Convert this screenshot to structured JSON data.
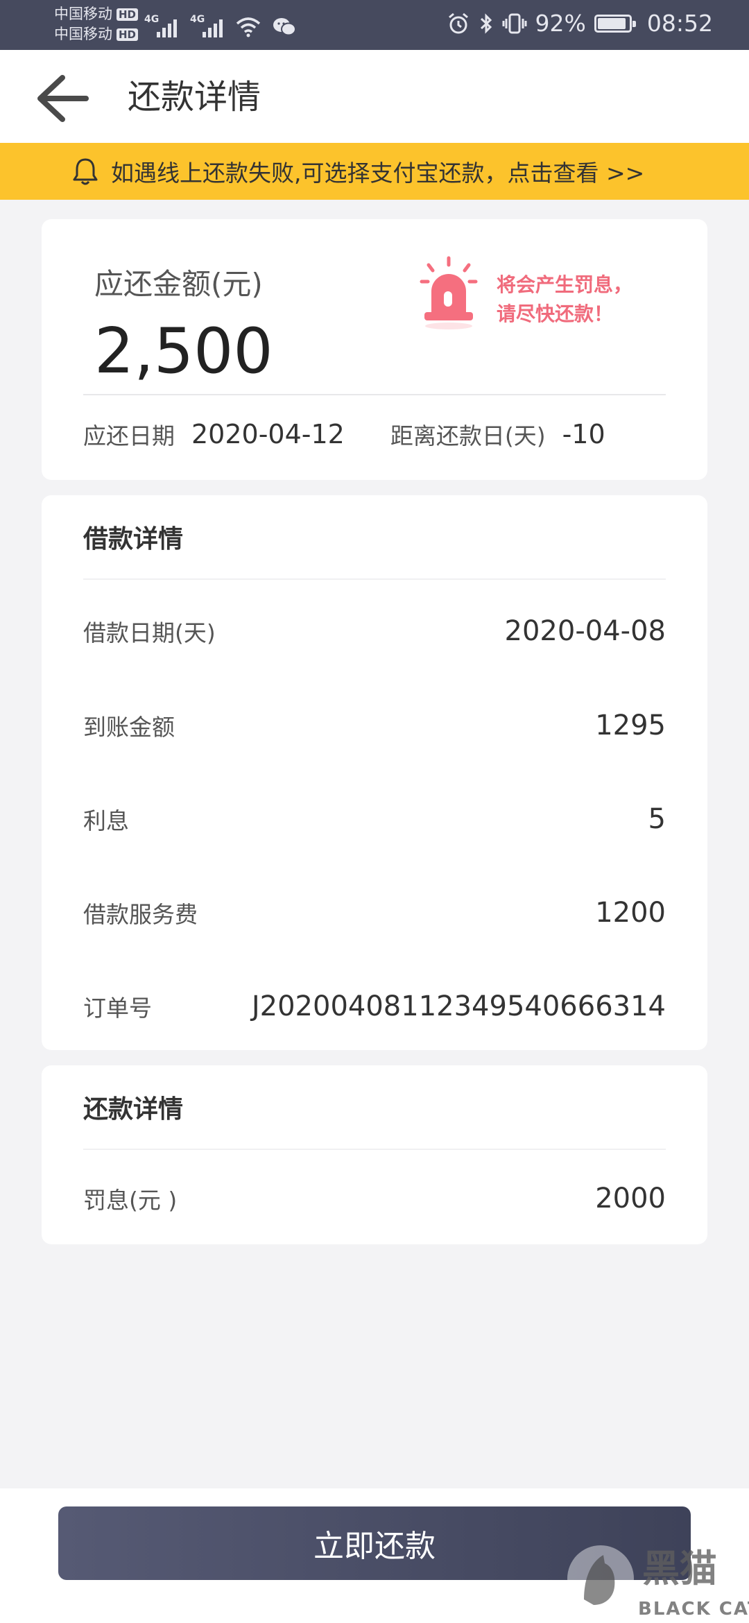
{
  "status_bar": {
    "carrier_1": "中国移动",
    "carrier_2": "中国移动",
    "hd_badge": "HD",
    "network_1": "4G",
    "network_2": "4G",
    "battery_percent": "92%",
    "battery_level": 0.92,
    "time": "08:52",
    "icons": [
      "signal-icon",
      "wifi-icon",
      "wechat-icon",
      "alarm-clock-icon",
      "bluetooth-icon",
      "vibrate-icon",
      "battery-icon"
    ]
  },
  "header": {
    "title": "还款详情",
    "back_icon": "arrow-left-icon"
  },
  "notice": {
    "icon": "bell-icon",
    "text": "如遇线上还款失败,可选择支付宝还款，点击查看 >>"
  },
  "amount_card": {
    "label": "应还金额(元)",
    "value": "2,500",
    "warning_line_1": "将会产生罚息，",
    "warning_line_2": "请尽快还款！",
    "warning_icon": "siren-icon",
    "due_label": "应还日期",
    "due_date": "2020-04-12",
    "days_label": "距离还款日(天)",
    "days_value": "-10"
  },
  "loan_details": {
    "title": "借款详情",
    "rows": [
      {
        "label": "借款日期(天)",
        "value": "2020-04-08"
      },
      {
        "label": "到账金额",
        "value": "1295"
      },
      {
        "label": "利息",
        "value": "5"
      },
      {
        "label": "借款服务费",
        "value": "1200"
      },
      {
        "label": "订单号",
        "value": "J202004081123495406663​14"
      }
    ]
  },
  "repay_details": {
    "title": "还款详情",
    "rows": [
      {
        "label": "罚息(元 )",
        "value": "2000"
      }
    ]
  },
  "footer": {
    "pay_button": "立即还款"
  },
  "watermark": {
    "cn": "黑猫",
    "en": "BLACK CAT"
  },
  "colors": {
    "status_bar": "#464a5e",
    "notice_bg": "#fcc32c",
    "warning": "#f06b7c",
    "button": "#4a4e66"
  }
}
